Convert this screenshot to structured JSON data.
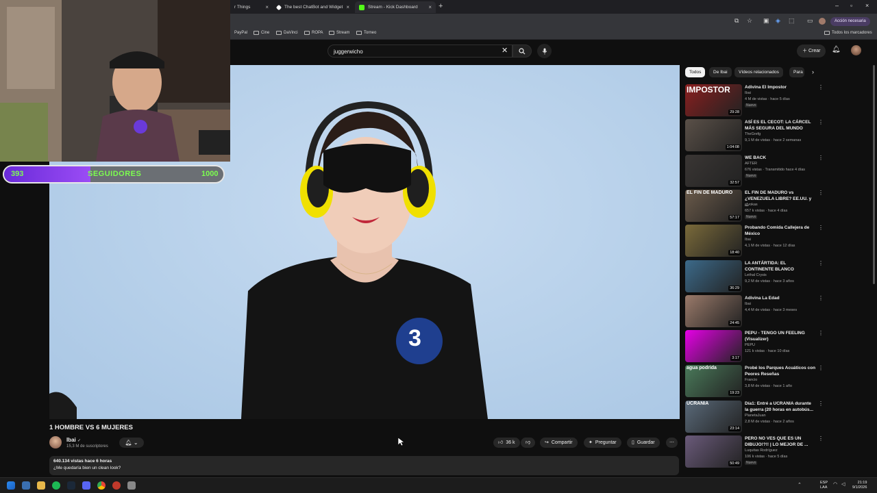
{
  "browser": {
    "tabs": [
      {
        "label": "r Things"
      },
      {
        "label": "The best ChatBot and Widget"
      },
      {
        "label": "Stream - Kick Dashboard"
      }
    ],
    "action_label": "Acción necesaria",
    "bookmarks": [
      "PayPal",
      "Cine",
      "DaVinci",
      "ROPA",
      "Stream",
      "Torneo"
    ],
    "all_bookmarks": "Todos los marcadores"
  },
  "header": {
    "search_value": "juggerwicho",
    "create_label": "Crear"
  },
  "overlay": {
    "followers_current": "393",
    "followers_label": "SEGUIDORES",
    "followers_goal": "1000",
    "progress_fraction": 0.393
  },
  "video": {
    "title": "1 HOMBRE VS 6 MUJERES",
    "channel": "Ibai",
    "subscribers": "15,3 M de suscriptores",
    "likes": "36 k",
    "share_label": "Compartir",
    "ask_label": "Preguntar",
    "save_label": "Guardar",
    "meta": "640.134 vistas  hace 6 horas",
    "description": "¿Me quedaría bien un clean look?",
    "badge_number": "3"
  },
  "sidebar": {
    "chips": [
      "Todos",
      "De Ibai",
      "Vídeos relacionados",
      "Para"
    ],
    "items": [
      {
        "title": "Adivina El Impostor",
        "channel": "Ibai",
        "views": "4 M de vistas · hace 5 días",
        "duration": "29:28",
        "badge": "Nuevo",
        "thumb_color": "#8a1f1f",
        "thumb_text": "IMPOSTOR"
      },
      {
        "title": "ASÍ ES EL CECOT: LA CÁRCEL MÁS SEGURA DEL MUNDO",
        "channel": "TheGrefg",
        "views": "9,1 M de vistas · hace 2 semanas",
        "duration": "1:04:08",
        "badge": "",
        "thumb_color": "#5a5048",
        "thumb_text": ""
      },
      {
        "title": "WE BACK",
        "channel": "AFTER",
        "views": "676 vistas · Transmitido hace 4 días",
        "duration": "32:57",
        "badge": "Nuevo",
        "thumb_color": "#3a3634",
        "thumb_text": ""
      },
      {
        "title": "EL FIN DE MADURO vs ¿VENEZUELA LIBRE? EE.UU. y ...",
        "channel": "elvokas",
        "views": "657 k vistas · hace 4 días",
        "duration": "57:17",
        "badge": "Nuevo",
        "thumb_color": "#6a5a4a",
        "thumb_text": "EL FIN DE MADURO"
      },
      {
        "title": "Probando Comida Callejera de México",
        "channel": "Ibai",
        "views": "4,1 M de vistas · hace 12 días",
        "duration": "18:40",
        "badge": "",
        "thumb_color": "#7a6a3a",
        "thumb_text": ""
      },
      {
        "title": "LA ANTÁRTIDA: EL CONTINENTE BLANCO",
        "channel": "Lethal Crysis",
        "views": "9,2 M de vistas · hace 3 años",
        "duration": "36:29",
        "badge": "",
        "thumb_color": "#3c6a8a",
        "thumb_text": ""
      },
      {
        "title": "Adivina La Edad",
        "channel": "Ibai",
        "views": "4,4 M de vistas · hace 3 meses",
        "duration": "24:45",
        "badge": "",
        "thumb_color": "#9a7a6a",
        "thumb_text": ""
      },
      {
        "title": "PEPU - TENGO UN FEELING (Visualizer)",
        "channel": "PEPU",
        "views": "121 k vistas · hace 10 días",
        "duration": "3:17",
        "badge": "",
        "thumb_color": "#e600e6",
        "thumb_text": ""
      },
      {
        "title": "Probé los Parques Acuáticos con Peores Reseñas",
        "channel": "Francio",
        "views": "3,8 M de vistas · hace 1 año",
        "duration": "19:23",
        "badge": "",
        "thumb_color": "#4a7a5a",
        "thumb_text": "agua podrida"
      },
      {
        "title": "Día1: Entré a UCRANIA durante la guerra (20 horas en autobús...",
        "channel": "PlanetaJuan",
        "views": "2,8 M de vistas · hace 2 años",
        "duration": "23:14",
        "badge": "",
        "thumb_color": "#5a6a7a",
        "thumb_text": "UCRANIA"
      },
      {
        "title": "PERO NO VES QUE ES UN DIBUJO!?!! | LO MEJOR DE ...",
        "channel": "Luquitas Rodríguez",
        "views": "106 k vistas · hace 5 días",
        "duration": "50:49",
        "badge": "Nuevo",
        "thumb_color": "#6a5a7a",
        "thumb_text": ""
      }
    ]
  },
  "taskbar": {
    "lang": "ESP",
    "lang2": "LAA",
    "time": "21:19",
    "date": "9/1/2026"
  },
  "colors": {
    "accent_purple": "#9b4cf5",
    "yt_bg": "#0f0f0f",
    "followers_text": "#7CFF4F"
  }
}
